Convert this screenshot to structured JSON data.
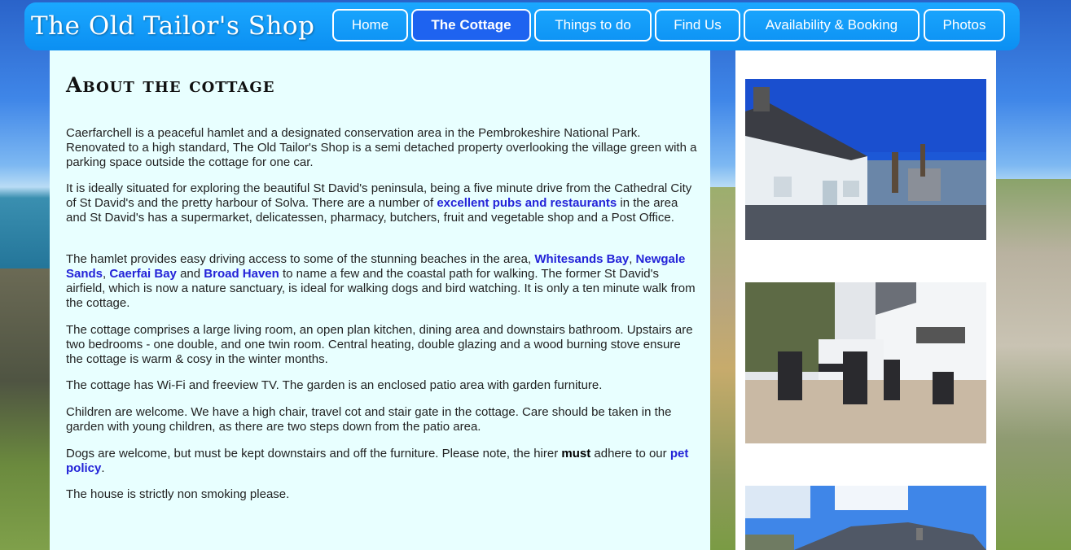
{
  "site": {
    "logo_text": "The Old Tailor's Shop"
  },
  "nav": {
    "items": [
      {
        "label": "Home"
      },
      {
        "label": "The Cottage"
      },
      {
        "label": "Things to do"
      },
      {
        "label": "Find Us"
      },
      {
        "label": "Availability & Booking"
      },
      {
        "label": "Photos"
      }
    ],
    "active": "The Cottage"
  },
  "main": {
    "heading": "About the cottage",
    "p1": "Caerfarchell is a peaceful hamlet and a designated conservation area in the Pembrokeshire National Park. Renovated to a high standard, The Old Tailor's Shop is a semi detached property overlooking the village green with a parking space outside the cottage for one car.",
    "p2_a": "It is ideally situated for exploring the beautiful St David's peninsula, being a five minute drive from the Cathedral City of St David's and the pretty harbour of Solva. There are a number of ",
    "p2_link": "excellent pubs and restaurants",
    "p2_b": " in the area and St David's has a supermarket, delicatessen, pharmacy, butchers, fruit and vegetable shop and a Post Office.",
    "p3_a": "The hamlet provides easy driving access to some of the stunning beaches in the area, ",
    "p3_link1": "Whitesands Bay",
    "p3_sep1": ", ",
    "p3_link2": "Newgale Sands",
    "p3_sep2": ", ",
    "p3_link3": "Caerfai Bay",
    "p3_sep3": " and ",
    "p3_link4": "Broad Haven",
    "p3_b": " to name a few and the coastal path for walking. The former St David's airfield, which is now a nature sanctuary, is ideal for walking dogs and bird watching. It is only a ten minute walk from the cottage.",
    "p4": "The cottage comprises a large living room, an open plan kitchen, dining area and downstairs bathroom. Upstairs are two bedrooms - one double, and one twin room. Central heating, double glazing and a wood burning stove ensure the cottage is warm & cosy in the winter months.",
    "p5": "The cottage has Wi-Fi and freeview TV. The garden is an enclosed patio area with garden furniture.",
    "p6": "Children are welcome. We have a high chair, travel cot and stair gate in the cottage. Care should be taken in the garden with young children, as there are two steps down from the patio area.",
    "p7_a": "Dogs are welcome, but must be kept downstairs and off the furniture. Please note, the hirer ",
    "p7_bold": "must",
    "p7_b": " adhere to our ",
    "p7_link": "pet policy",
    "p7_c": ".",
    "p8": "The house is strictly non smoking please."
  },
  "sidebar": {
    "photos": [
      "cottage-exterior-photo",
      "patio-garden-photo",
      "cottage-roof-photo"
    ]
  },
  "colors": {
    "nav_bg": "#0b8ff2",
    "nav_active": "#1e63f0",
    "content_bg": "#e8ffff",
    "link": "#2323d8"
  }
}
